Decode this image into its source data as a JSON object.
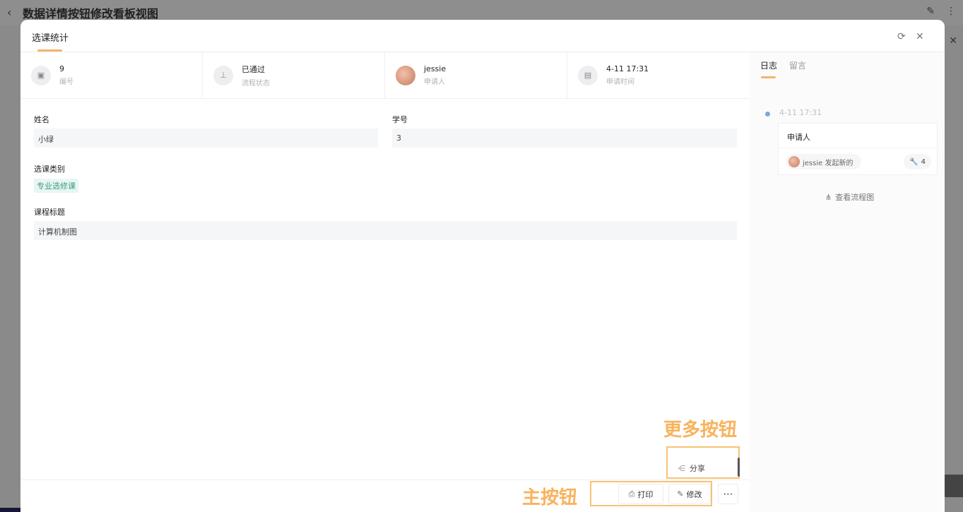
{
  "page": {
    "title": "数据详情按钮修改看板视图"
  },
  "modal": {
    "title": "选课统计",
    "info": [
      {
        "value": "9",
        "label": "编号"
      },
      {
        "value": "已通过",
        "label": "流程状态"
      },
      {
        "value": "jessie",
        "label": "申请人"
      },
      {
        "value": "4-11 17:31",
        "label": "申请时间"
      }
    ],
    "fields": {
      "name_label": "姓名",
      "name_value": "小绿",
      "id_label": "学号",
      "id_value": "3",
      "category_label": "选课类别",
      "category_value": "专业选修课",
      "course_label": "课程标题",
      "course_value": "计算机制图"
    },
    "footer": {
      "print_label": "打印",
      "edit_label": "修改",
      "more_label": "⋯",
      "share_label": "分享"
    }
  },
  "annotations": {
    "more": "更多按钮",
    "main": "主按钮"
  },
  "right_panel": {
    "tabs": [
      "日志",
      "留言"
    ],
    "log": {
      "time": "4-11 17:31",
      "title": "申请人",
      "user_action": "jessie 发起新的",
      "count": "4",
      "flow_link": "查看流程图"
    }
  },
  "colors": {
    "accent": "#f7b36b",
    "annotation": "#f8b35d",
    "tag_text": "#3f9a87"
  }
}
